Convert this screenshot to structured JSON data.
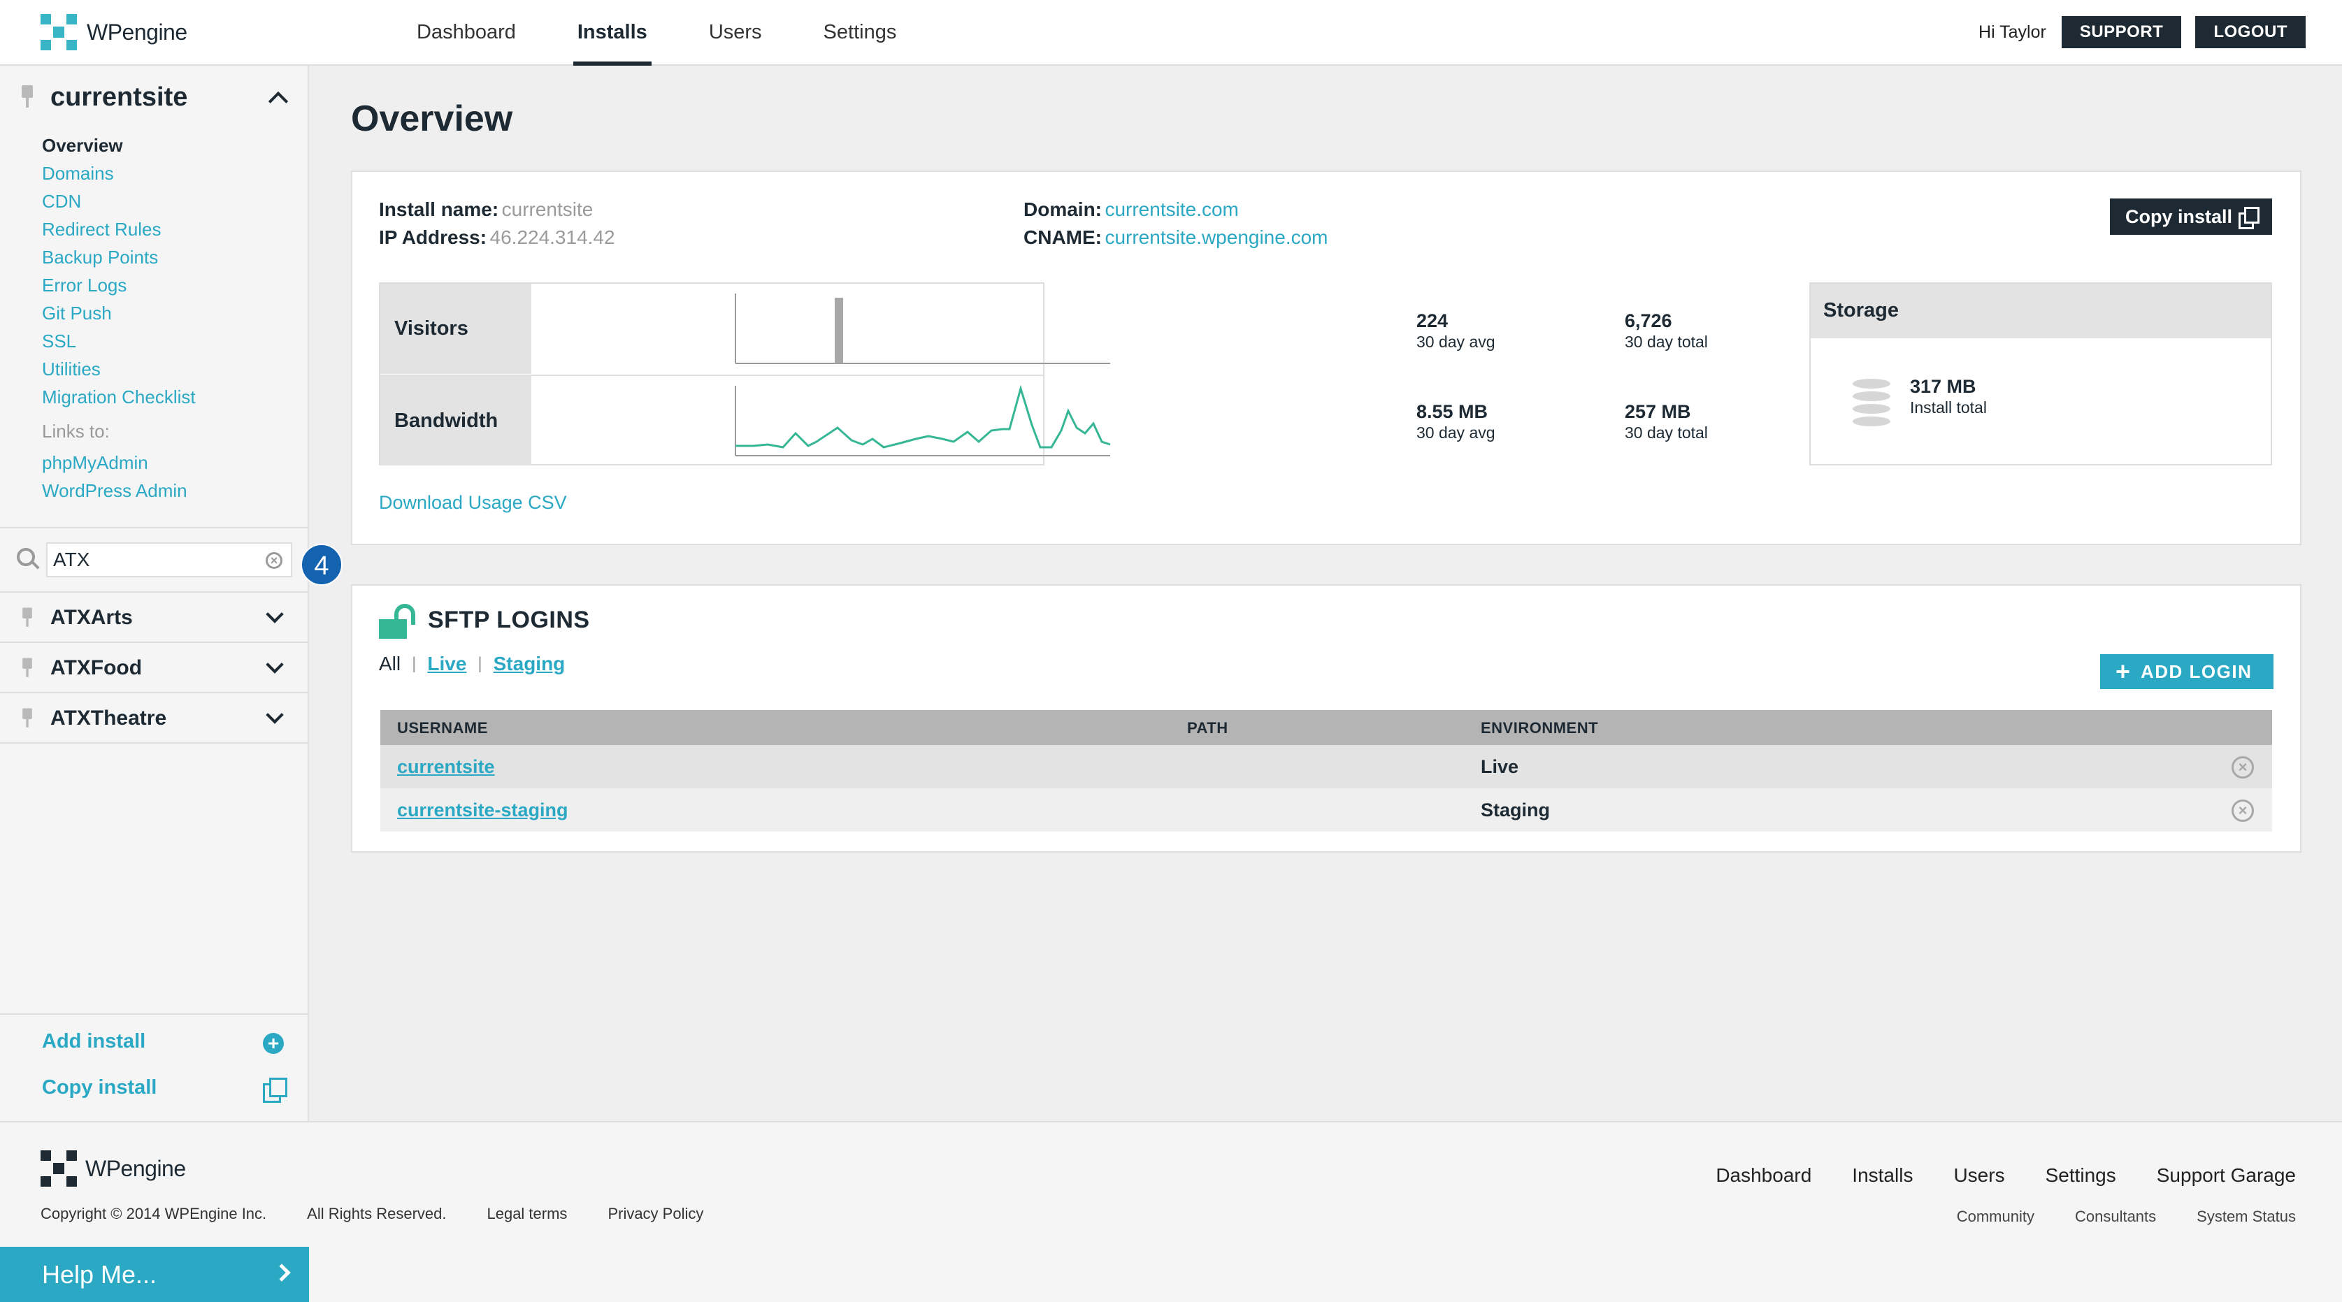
{
  "brand": {
    "logo_bold": "WP",
    "logo_rest": "engine"
  },
  "nav": [
    "Dashboard",
    "Installs",
    "Users",
    "Settings"
  ],
  "header": {
    "greeting": "Hi Taylor",
    "support": "SUPPORT",
    "logout": "LOGOUT"
  },
  "sidebar": {
    "install": "currentsite",
    "links": [
      "Overview",
      "Domains",
      "CDN",
      "Redirect Rules",
      "Backup Points",
      "Error Logs",
      "Git Push",
      "SSL",
      "Utilities",
      "Migration Checklist"
    ],
    "links_to_label": "Links to:",
    "external_links": [
      "phpMyAdmin",
      "WordPress Admin"
    ],
    "search_value": "ATX",
    "step_badge": "4",
    "results": [
      "ATXArts",
      "ATXFood",
      "ATXTheatre"
    ],
    "add_install": "Add install",
    "copy_install": "Copy install"
  },
  "overview": {
    "title": "Overview",
    "install_name_label": "Install name:",
    "install_name": "currentsite",
    "ip_label": "IP Address:",
    "ip": "46.224.314.42",
    "domain_label": "Domain:",
    "domain": "currentsite.com",
    "cname_label": "CNAME:",
    "cname": "currentsite.wpengine.com",
    "copy_install": "Copy install",
    "visitors_label": "Visitors",
    "visitors_avg": "224",
    "visitors_avg_label": "30 day avg",
    "visitors_total": "6,726",
    "visitors_total_label": "30 day total",
    "bandwidth_label": "Bandwidth",
    "bandwidth_avg": "8.55 MB",
    "bandwidth_avg_label": "30 day avg",
    "bandwidth_total": "257 MB",
    "bandwidth_total_label": "30 day total",
    "storage_label": "Storage",
    "storage_value": "317 MB",
    "storage_sub": "Install total",
    "download_csv": "Download Usage CSV"
  },
  "sftp": {
    "title": "SFTP LOGINS",
    "filter_all": "All",
    "filter_live": "Live",
    "filter_staging": "Staging",
    "add_login": "ADD LOGIN",
    "columns": [
      "USERNAME",
      "PATH",
      "ENVIRONMENT"
    ],
    "rows": [
      {
        "username": "currentsite",
        "path": "",
        "environment": "Live"
      },
      {
        "username": "currentsite-staging",
        "path": "",
        "environment": "Staging"
      }
    ]
  },
  "footer": {
    "legal": [
      "Copyright © 2014 WPEngine Inc.",
      "All Rights Reserved.",
      "Legal terms",
      "Privacy Policy"
    ],
    "nav": [
      "Dashboard",
      "Installs",
      "Users",
      "Settings",
      "Support Garage"
    ],
    "nav2": [
      "Community",
      "Consultants",
      "System Status"
    ],
    "help": "Help Me..."
  },
  "colors": {
    "accent": "#2aa8c4",
    "dark": "#1e2a33",
    "sparkline": "#35b796",
    "badge": "#1463b0"
  }
}
